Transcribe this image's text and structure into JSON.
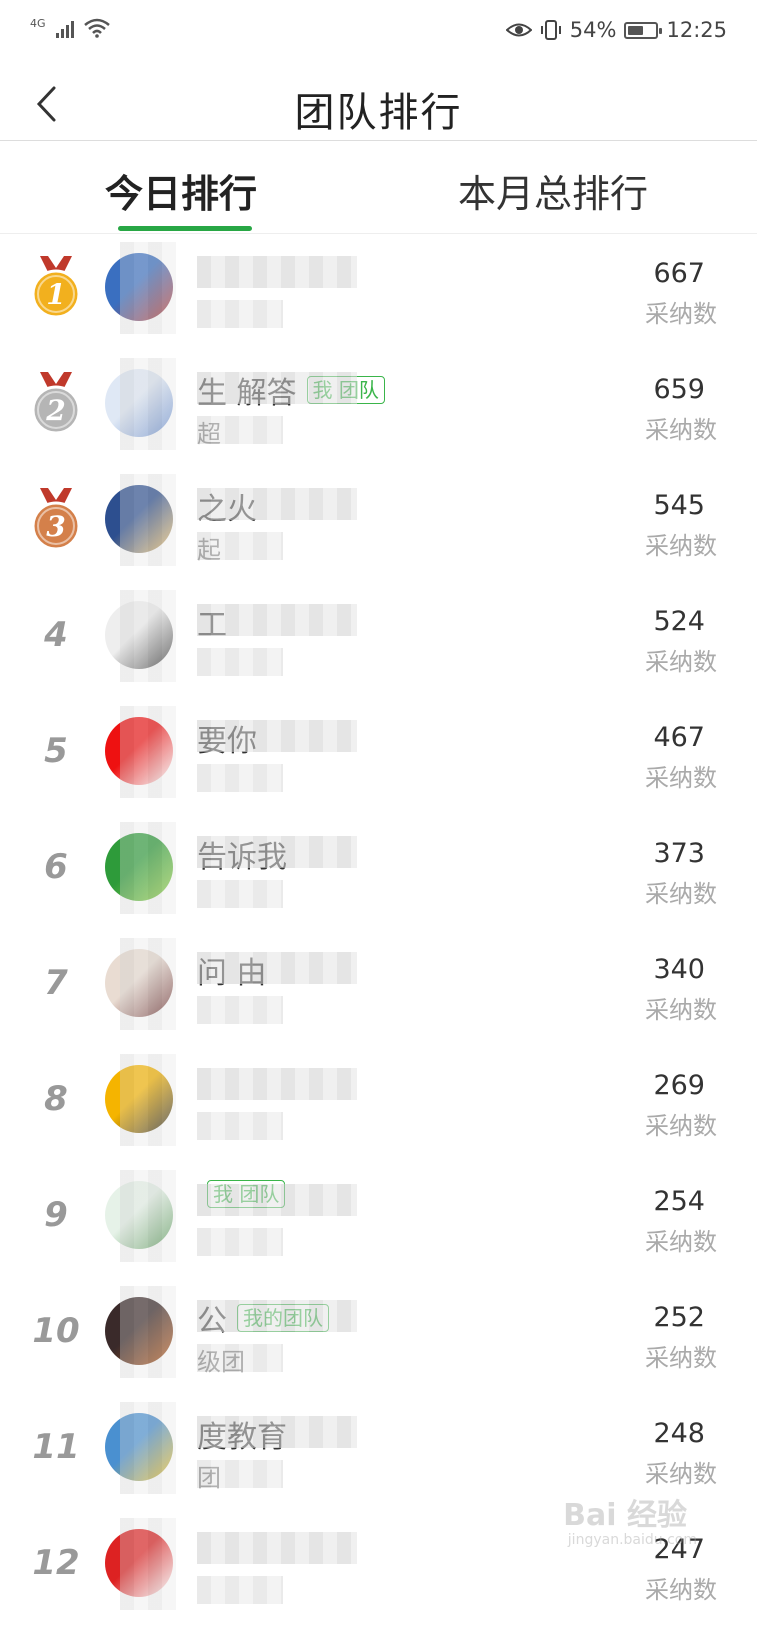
{
  "status_bar": {
    "network": "4G",
    "battery_text": "54%",
    "battery_level": 0.54,
    "time": "12:25",
    "icons": [
      "signal-icon",
      "wifi-icon",
      "eye-icon",
      "vibrate-icon",
      "battery-icon"
    ]
  },
  "nav": {
    "title": "团队排行",
    "back_icon": "chevron-left-icon"
  },
  "tabs": [
    {
      "label": "今日排行",
      "active": true
    },
    {
      "label": "本月总排行",
      "active": false
    }
  ],
  "colors": {
    "accent": "#28a745",
    "tag": "#3ab54a",
    "gold": "#f2b01e",
    "silver": "#b5b5b5",
    "bronze": "#d4804a"
  },
  "count_label": "采纳数",
  "rows": [
    {
      "rank": "1",
      "medal": "gold",
      "name": "",
      "tag": "",
      "sub": "",
      "count": "667"
    },
    {
      "rank": "2",
      "medal": "silver",
      "name": "生  解答",
      "tag": "我 团队",
      "sub": "超",
      "count": "659"
    },
    {
      "rank": "3",
      "medal": "bronze",
      "name": "  之火",
      "tag": "",
      "sub": "起",
      "count": "545"
    },
    {
      "rank": "4",
      "medal": "",
      "name": "   工",
      "tag": "",
      "sub": "",
      "count": "524"
    },
    {
      "rank": "5",
      "medal": "",
      "name": "  要你",
      "tag": "",
      "sub": "",
      "count": "467"
    },
    {
      "rank": "6",
      "medal": "",
      "name": "  告诉我",
      "tag": "",
      "sub": "",
      "count": "373"
    },
    {
      "rank": "7",
      "medal": "",
      "name": "   问  由",
      "tag": "",
      "sub": "",
      "count": "340"
    },
    {
      "rank": "8",
      "medal": "",
      "name": "",
      "tag": "",
      "sub": "",
      "count": "269"
    },
    {
      "rank": "9",
      "medal": "",
      "name": "",
      "tag": "我 团队",
      "sub": "",
      "count": "254"
    },
    {
      "rank": "10",
      "medal": "",
      "name": "  公 ",
      "tag": "我的团队",
      "sub": "级团",
      "count": "252"
    },
    {
      "rank": "11",
      "medal": "",
      "name": " 度教育 ",
      "tag": "",
      "sub": " 团",
      "count": "248"
    },
    {
      "rank": "12",
      "medal": "",
      "name": "",
      "tag": "",
      "sub": "",
      "count": "247"
    }
  ],
  "watermark": {
    "text": "Bai 经验",
    "sub": "jingyan.baidu.com"
  }
}
